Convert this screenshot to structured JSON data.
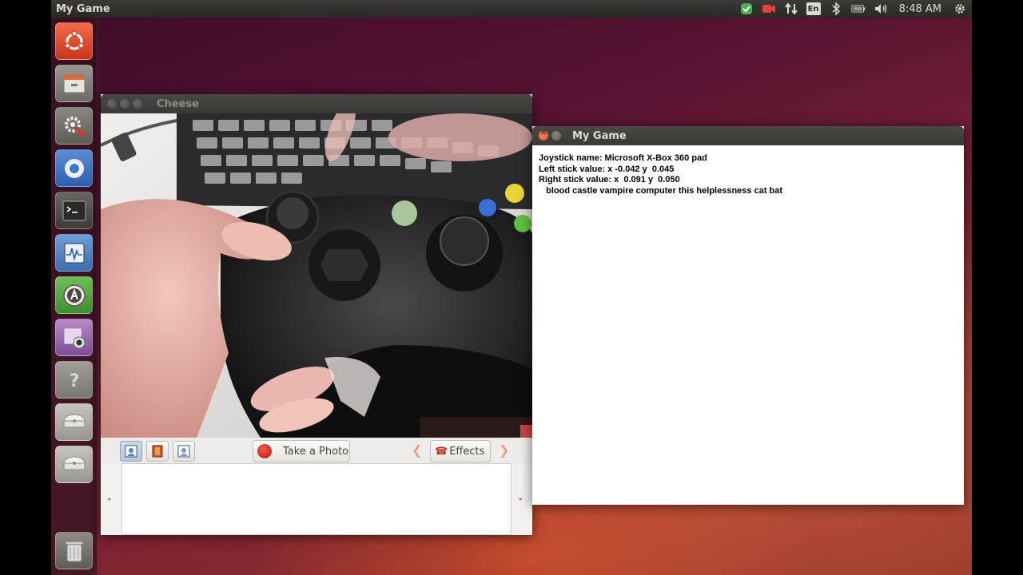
{
  "top_panel": {
    "app_title": "My Game",
    "language_indicator": "En",
    "clock": "8:48 AM",
    "indicators": [
      "chat-icon",
      "camera-recording-icon",
      "network-icon",
      "keyboard-language-icon",
      "bluetooth-icon",
      "battery-icon",
      "volume-icon",
      "gear-icon"
    ]
  },
  "launcher": {
    "items": [
      "ubuntu-dash-icon",
      "files-icon",
      "system-settings-icon",
      "chromium-icon",
      "terminal-icon",
      "system-monitor-icon",
      "software-updater-icon",
      "cheese-webcam-icon",
      "help-icon",
      "disk-drive-icon",
      "disk-drive-icon",
      "trash-icon"
    ]
  },
  "cheese_window": {
    "title": "Cheese",
    "take_photo_label": "Take a Photo",
    "effects_label": "Effects"
  },
  "game_window": {
    "title": "My Game",
    "lines": [
      "Joystick name: Microsoft X-Box 360 pad",
      "Left stick value: x -0.042 y  0.045",
      "Right stick value: x  0.091 y  0.050",
      "   blood castle vampire computer this helplessness cat bat"
    ]
  },
  "colors": {
    "panel_bg": "#2f2e2b",
    "close_button": "#df4b27",
    "wallpaper_dark": "#3d0c2a",
    "wallpaper_light": "#e8743e"
  }
}
